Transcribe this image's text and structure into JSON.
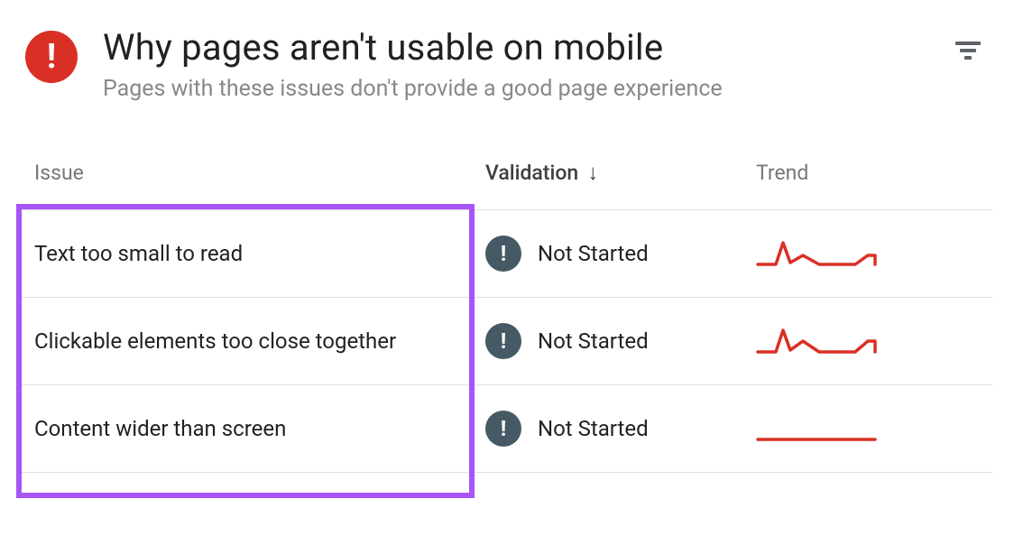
{
  "header": {
    "title": "Why pages aren't usable on mobile",
    "subtitle": "Pages with these issues don't provide a good page experience"
  },
  "columns": {
    "issue": "Issue",
    "validation": "Validation",
    "trend": "Trend"
  },
  "status_label": "Not Started",
  "rows": [
    {
      "issue": "Text too small to read",
      "status": "Not Started",
      "spark": "spike"
    },
    {
      "issue": "Clickable elements too close together",
      "status": "Not Started",
      "spark": "spike"
    },
    {
      "issue": "Content wider than screen",
      "status": "Not Started",
      "spark": "flat"
    }
  ]
}
